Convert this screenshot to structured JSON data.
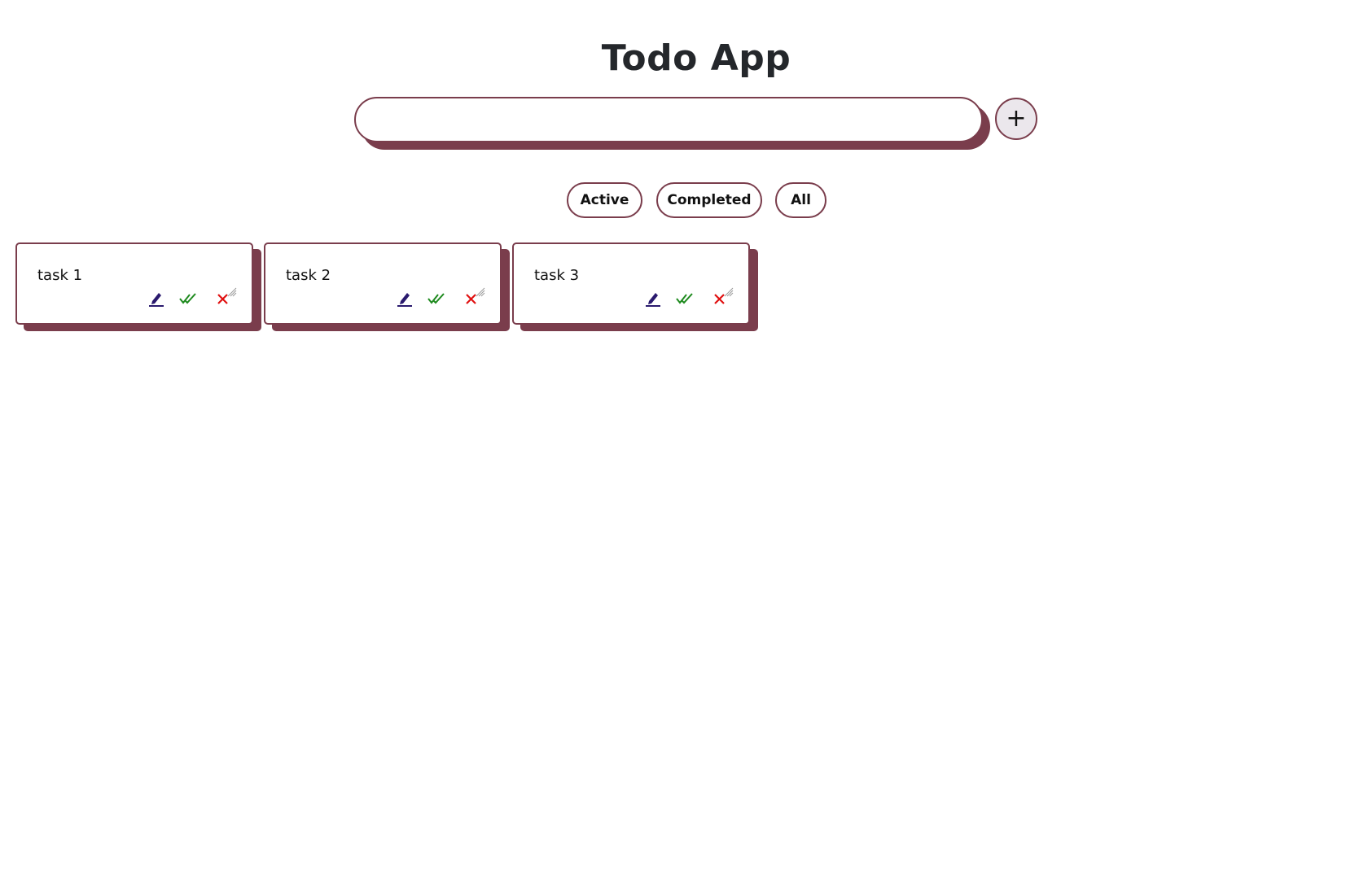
{
  "app": {
    "title": "Todo App"
  },
  "new_task": {
    "value": "",
    "placeholder": "",
    "add_label": "+"
  },
  "filters": [
    {
      "label": "Active"
    },
    {
      "label": "Completed"
    },
    {
      "label": "All"
    }
  ],
  "tasks": [
    {
      "text": "task 1"
    },
    {
      "text": "task 2"
    },
    {
      "text": "task 3"
    }
  ],
  "icons": {
    "edit": "pencil-icon",
    "complete": "double-check-icon",
    "delete": "close-icon"
  },
  "colors": {
    "accent": "#7a3d4c",
    "title": "#24272b",
    "edit": "#2a1a6e",
    "complete": "#1e8a1e",
    "delete": "#e01010",
    "add_button_bg": "#ebe7ec"
  }
}
